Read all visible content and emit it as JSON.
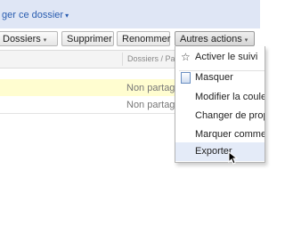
{
  "header": {
    "share_label": "ger ce dossier",
    "share_caret": "▾"
  },
  "toolbar": {
    "folders_label": "Dossiers",
    "delete_label": "Supprimer",
    "rename_label": "Renommer",
    "more_actions_label": "Autres actions",
    "caret": "▾"
  },
  "list": {
    "column_header": "Dossiers / Par",
    "rows": [
      {
        "status": "Non partagé"
      },
      {
        "status": "Non partagé"
      }
    ]
  },
  "menu": {
    "items": [
      {
        "label": "Activer le suivi",
        "icon": "star-icon"
      },
      {
        "label": "Masquer",
        "icon": "document-icon"
      },
      {
        "label": "Modifier la couleu"
      },
      {
        "label": "Changer de propr"
      },
      {
        "label": "Marquer comme r"
      },
      {
        "label": "Exporter"
      }
    ]
  },
  "colors": {
    "accent": "#2a5db0",
    "topbar": "#dfe6f5",
    "highlight_row": "#fffdd0",
    "menu_hover": "#e4ebf8"
  }
}
